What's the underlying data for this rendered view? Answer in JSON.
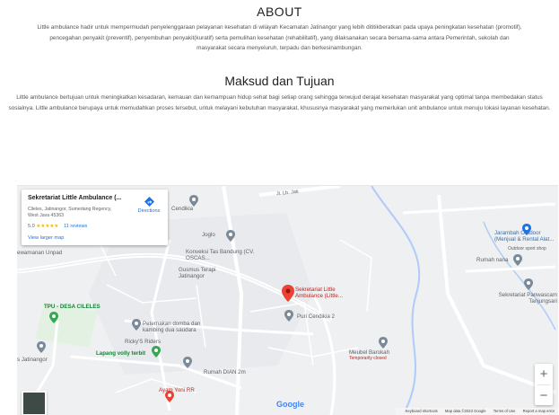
{
  "about": {
    "heading": "ABOUT",
    "text": "Little ambulance hadir untuk mempermudah penyelenggaraan pelayanan kesehatan di wilayah Kecamatan Jatinangor yang lebih dititikberatkan pada upaya peningkatan kesehatan (promotif), pencegahan penyakit (preventif), penyembuhan penyakit(kuratif) serta pemulihan kesehatan (rehabilitatif), yang dilaksanakan secara bersama-sama antara Pemerintah, sekolah dan masyarakat secara menyeluruh, terpadu dan berkesinambungan."
  },
  "maksud": {
    "heading": "Maksud dan Tujuan",
    "text": "Little ambulance bertujuan untuk meningkatkan kesadaran, kemauan dan kemampuan hidup sehat bagi setiap orang sehingga terwujud derajat kesehatan masyarakat yang optimal tanpa membedakan status sosialnya. Little ambulance berupaya untuk memudahkan proses tersebut, untuk melayani kebutuhan masyarakat, khususnya masyarakat yang memerlukan unit ambulance untuk menuju lokasi layanan kesehatan."
  },
  "map": {
    "card": {
      "title": "Sekretariat Little Ambulance (...",
      "address": "Cileles, Jatinangor, Sumedang Regency, West Java 45363",
      "rating": "5.0",
      "stars": "★★★★★",
      "reviews": "11 reviews",
      "larger_map": "View larger map",
      "directions": "Directions"
    },
    "places": {
      "main_pin": "Sekretariat Little Ambulance (Little...",
      "cendikia": "Cendikia",
      "joglo": "Joglo",
      "konveksi": "Konveksi Tas Bandung (CV. OSCAS...",
      "gusmus": "Gusmus Terapi Jatinangor",
      "puri": "Puri Cendikia 2",
      "peternakan": "Peternakan domba dan kambing dua saudara",
      "rickys": "Ricky'S Riders",
      "lapang": "Lapang volly terbit",
      "rumah_dian": "Rumah DIAN 2m",
      "ayam": "Ayam Yoni RR",
      "tpu": "TPU - DESA CILELES",
      "jatinangor": "s Jatinangor",
      "unpad": "ewamanan Unpad",
      "meubel": "Meubel Barokah",
      "meubel_sub": "Temporarily closed",
      "jarambah": "Jarambah Outdoor (Menjual & Rental Alat...",
      "jarambah_sub": "Outdoor sport shop",
      "rumah_nana": "Rumah nana",
      "panwascam": "Sekretariat Panwascam Tanjungsari",
      "street": "Jl. Lb. Jati"
    },
    "google": "Google",
    "footer": {
      "shortcuts": "Keyboard shortcuts",
      "mapdata": "Map data ©2023 Google",
      "terms": "Terms of Use",
      "report": "Report a map error"
    },
    "zoom_in": "+",
    "zoom_out": "−"
  }
}
